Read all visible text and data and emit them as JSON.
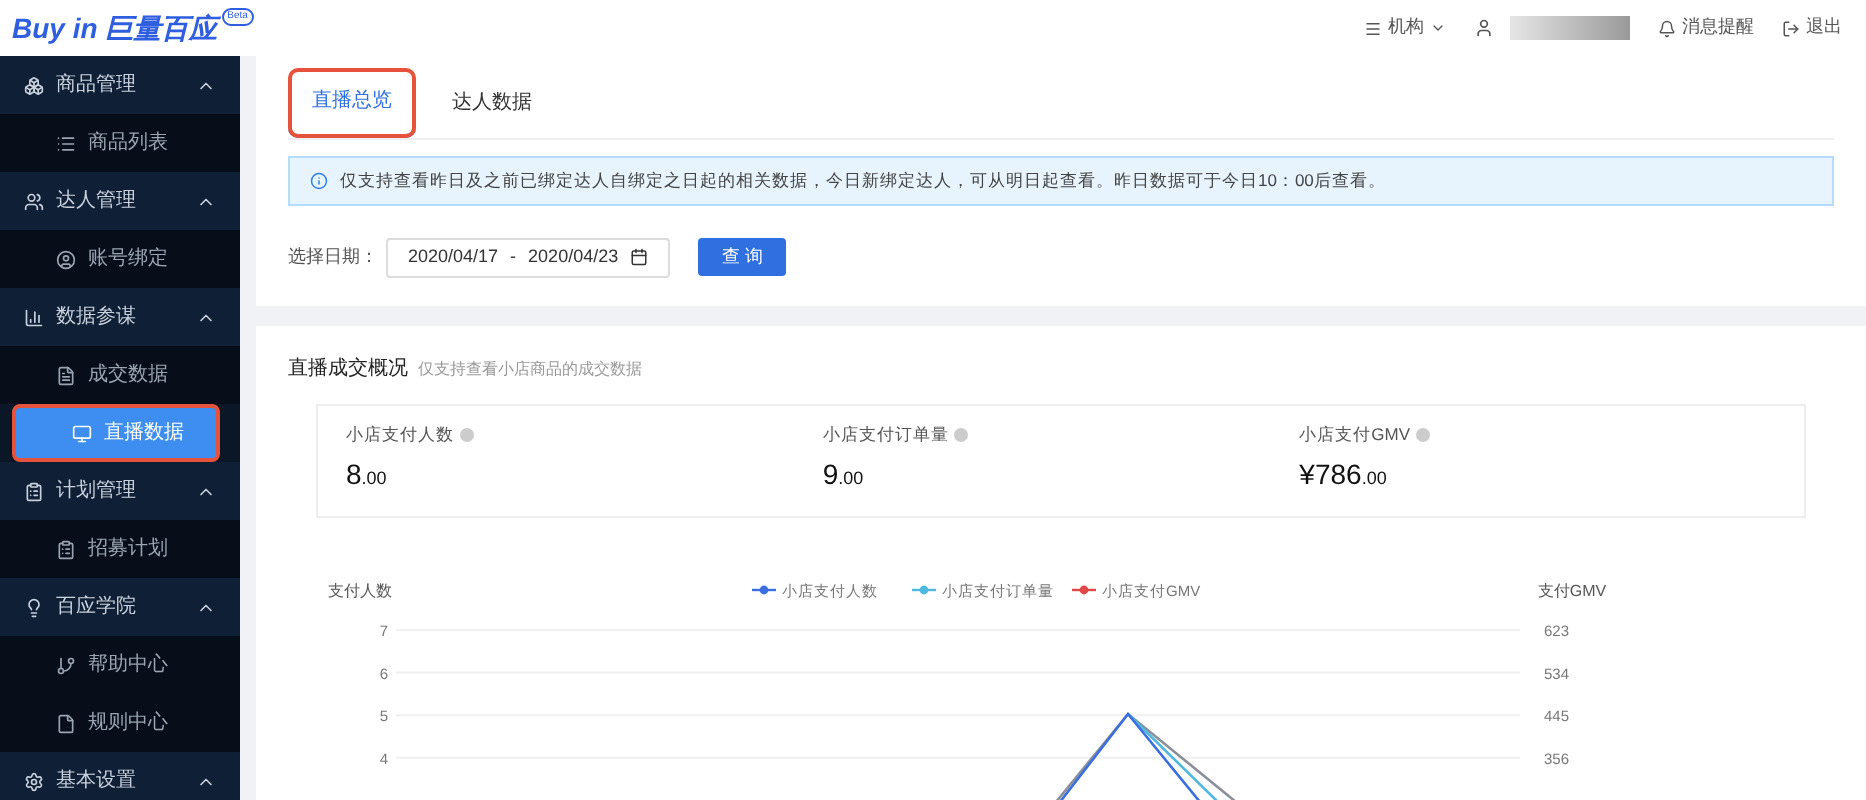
{
  "header": {
    "logo": "Buy in 巨量百应",
    "logo_badge": "Beta",
    "org_menu": "机构",
    "notifications": "消息提醒",
    "logout": "退出"
  },
  "sidebar": {
    "items": [
      {
        "label": "商品管理",
        "expanded": true,
        "children": [
          {
            "label": "商品列表",
            "selected": false,
            "highlighted": false
          }
        ]
      },
      {
        "label": "达人管理",
        "expanded": true,
        "children": [
          {
            "label": "账号绑定",
            "selected": false,
            "highlighted": false
          }
        ]
      },
      {
        "label": "数据参谋",
        "expanded": true,
        "children": [
          {
            "label": "成交数据",
            "selected": false,
            "highlighted": false
          },
          {
            "label": "直播数据",
            "selected": true,
            "highlighted": true
          }
        ]
      },
      {
        "label": "计划管理",
        "expanded": true,
        "children": [
          {
            "label": "招募计划",
            "selected": false,
            "highlighted": false
          }
        ]
      },
      {
        "label": "百应学院",
        "expanded": true,
        "children": [
          {
            "label": "帮助中心",
            "selected": false,
            "highlighted": false
          },
          {
            "label": "规则中心",
            "selected": false,
            "highlighted": false
          }
        ]
      },
      {
        "label": "基本设置",
        "expanded": true
      }
    ]
  },
  "tabs": [
    {
      "label": "直播总览",
      "selected": true,
      "highlighted": true
    },
    {
      "label": "达人数据",
      "selected": false,
      "highlighted": false
    }
  ],
  "notice": "仅支持查看昨日及之前已绑定达人自绑定之日起的相关数据，今日新绑定达人，可从明日起查看。昨日数据可于今日10：00后查看。",
  "date_filter": {
    "label": "选择日期：",
    "start": "2020/04/17",
    "separator": "-",
    "end": "2020/04/23",
    "button": "查 询"
  },
  "overview": {
    "title": "直播成交概况",
    "subtitle": "仅支持查看小店商品的成交数据",
    "stats": [
      {
        "label": "小店支付人数",
        "value": "8",
        "decimals": ".00"
      },
      {
        "label": "小店支付订单量",
        "value": "9",
        "decimals": ".00"
      },
      {
        "label": "小店支付GMV",
        "value": "¥786",
        "decimals": ".00"
      }
    ],
    "chart": {
      "ylabel": "支付人数",
      "y2label": "支付GMV",
      "yticks": [
        "7",
        "6",
        "5",
        "4"
      ],
      "y2ticks": [
        "623",
        "534",
        "445",
        "356"
      ],
      "legend": [
        {
          "name": "小店支付人数",
          "color": "#3b6fe0"
        },
        {
          "name": "小店支付订单量",
          "color": "#4fb8e0"
        },
        {
          "name": "小店支付GMV",
          "color": "#e04848"
        }
      ]
    }
  }
}
